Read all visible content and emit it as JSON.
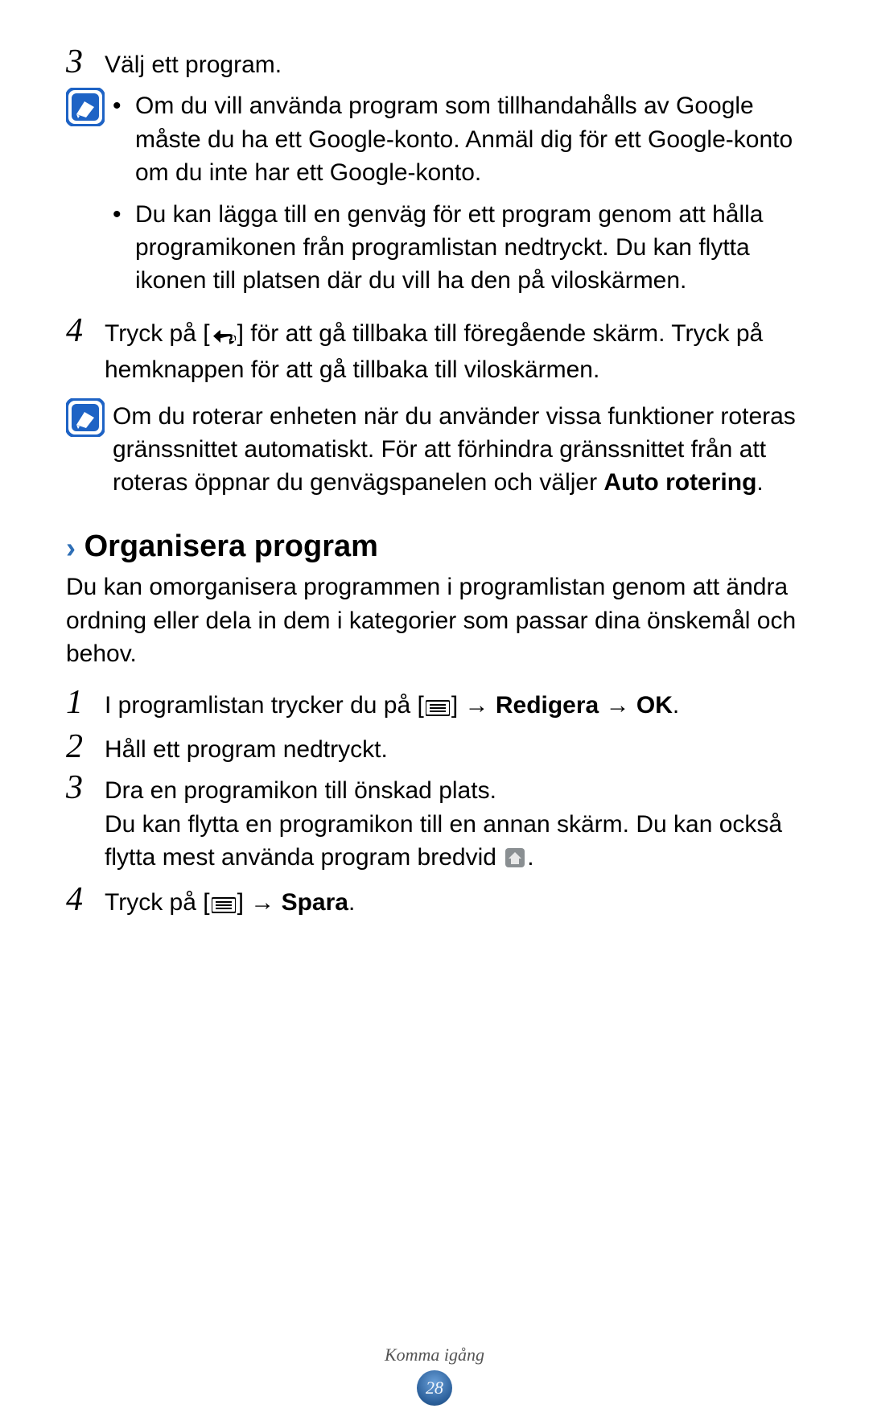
{
  "steps_top": {
    "s3": {
      "num": "3",
      "text": "Välj ett program."
    },
    "s4": {
      "num": "4",
      "text_a": "Tryck på [",
      "text_b": "] för att gå tillbaka till föregående skärm. Tryck på hemknappen för att gå tillbaka till viloskärmen."
    }
  },
  "note1": {
    "b1": "Om du vill använda program som tillhandahålls av Google måste du ha ett Google-konto. Anmäl dig för ett Google-konto om du inte har ett Google-konto.",
    "b2": "Du kan lägga till en genväg för ett program genom att hålla programikonen från programlistan nedtryckt. Du kan flytta ikonen till platsen där du vill ha den på viloskärmen."
  },
  "note2": {
    "text_a": "Om du roterar enheten när du använder vissa funktioner roteras gränssnittet automatiskt. För att förhindra gränssnittet från att roteras öppnar du genvägspanelen och väljer ",
    "bold": "Auto rotering",
    "text_b": "."
  },
  "section": {
    "chev": "›",
    "title": "Organisera program",
    "intro": "Du kan omorganisera programmen i programlistan genom att ändra ordning eller dela in dem i kategorier som passar dina önskemål och behov."
  },
  "steps_section": {
    "s1": {
      "num": "1",
      "text_a": "I programlistan trycker du på [",
      "text_b": "] → ",
      "bold1": "Redigera",
      "arrow": " → ",
      "bold2": "OK",
      "text_c": "."
    },
    "s2": {
      "num": "2",
      "text": "Håll ett program nedtryckt."
    },
    "s3": {
      "num": "3",
      "line1": "Dra en programikon till önskad plats.",
      "line2_a": "Du kan flytta en programikon till en annan skärm. Du kan också flytta mest använda program bredvid ",
      "line2_b": "."
    },
    "s4": {
      "num": "4",
      "text_a": "Tryck på [",
      "text_b": "] → ",
      "bold": "Spara",
      "text_c": "."
    }
  },
  "footer": {
    "section": "Komma igång",
    "page": "28"
  },
  "icons": {
    "note": "note-icon",
    "back": "back-icon",
    "menu": "menu-icon",
    "home": "home-icon"
  }
}
